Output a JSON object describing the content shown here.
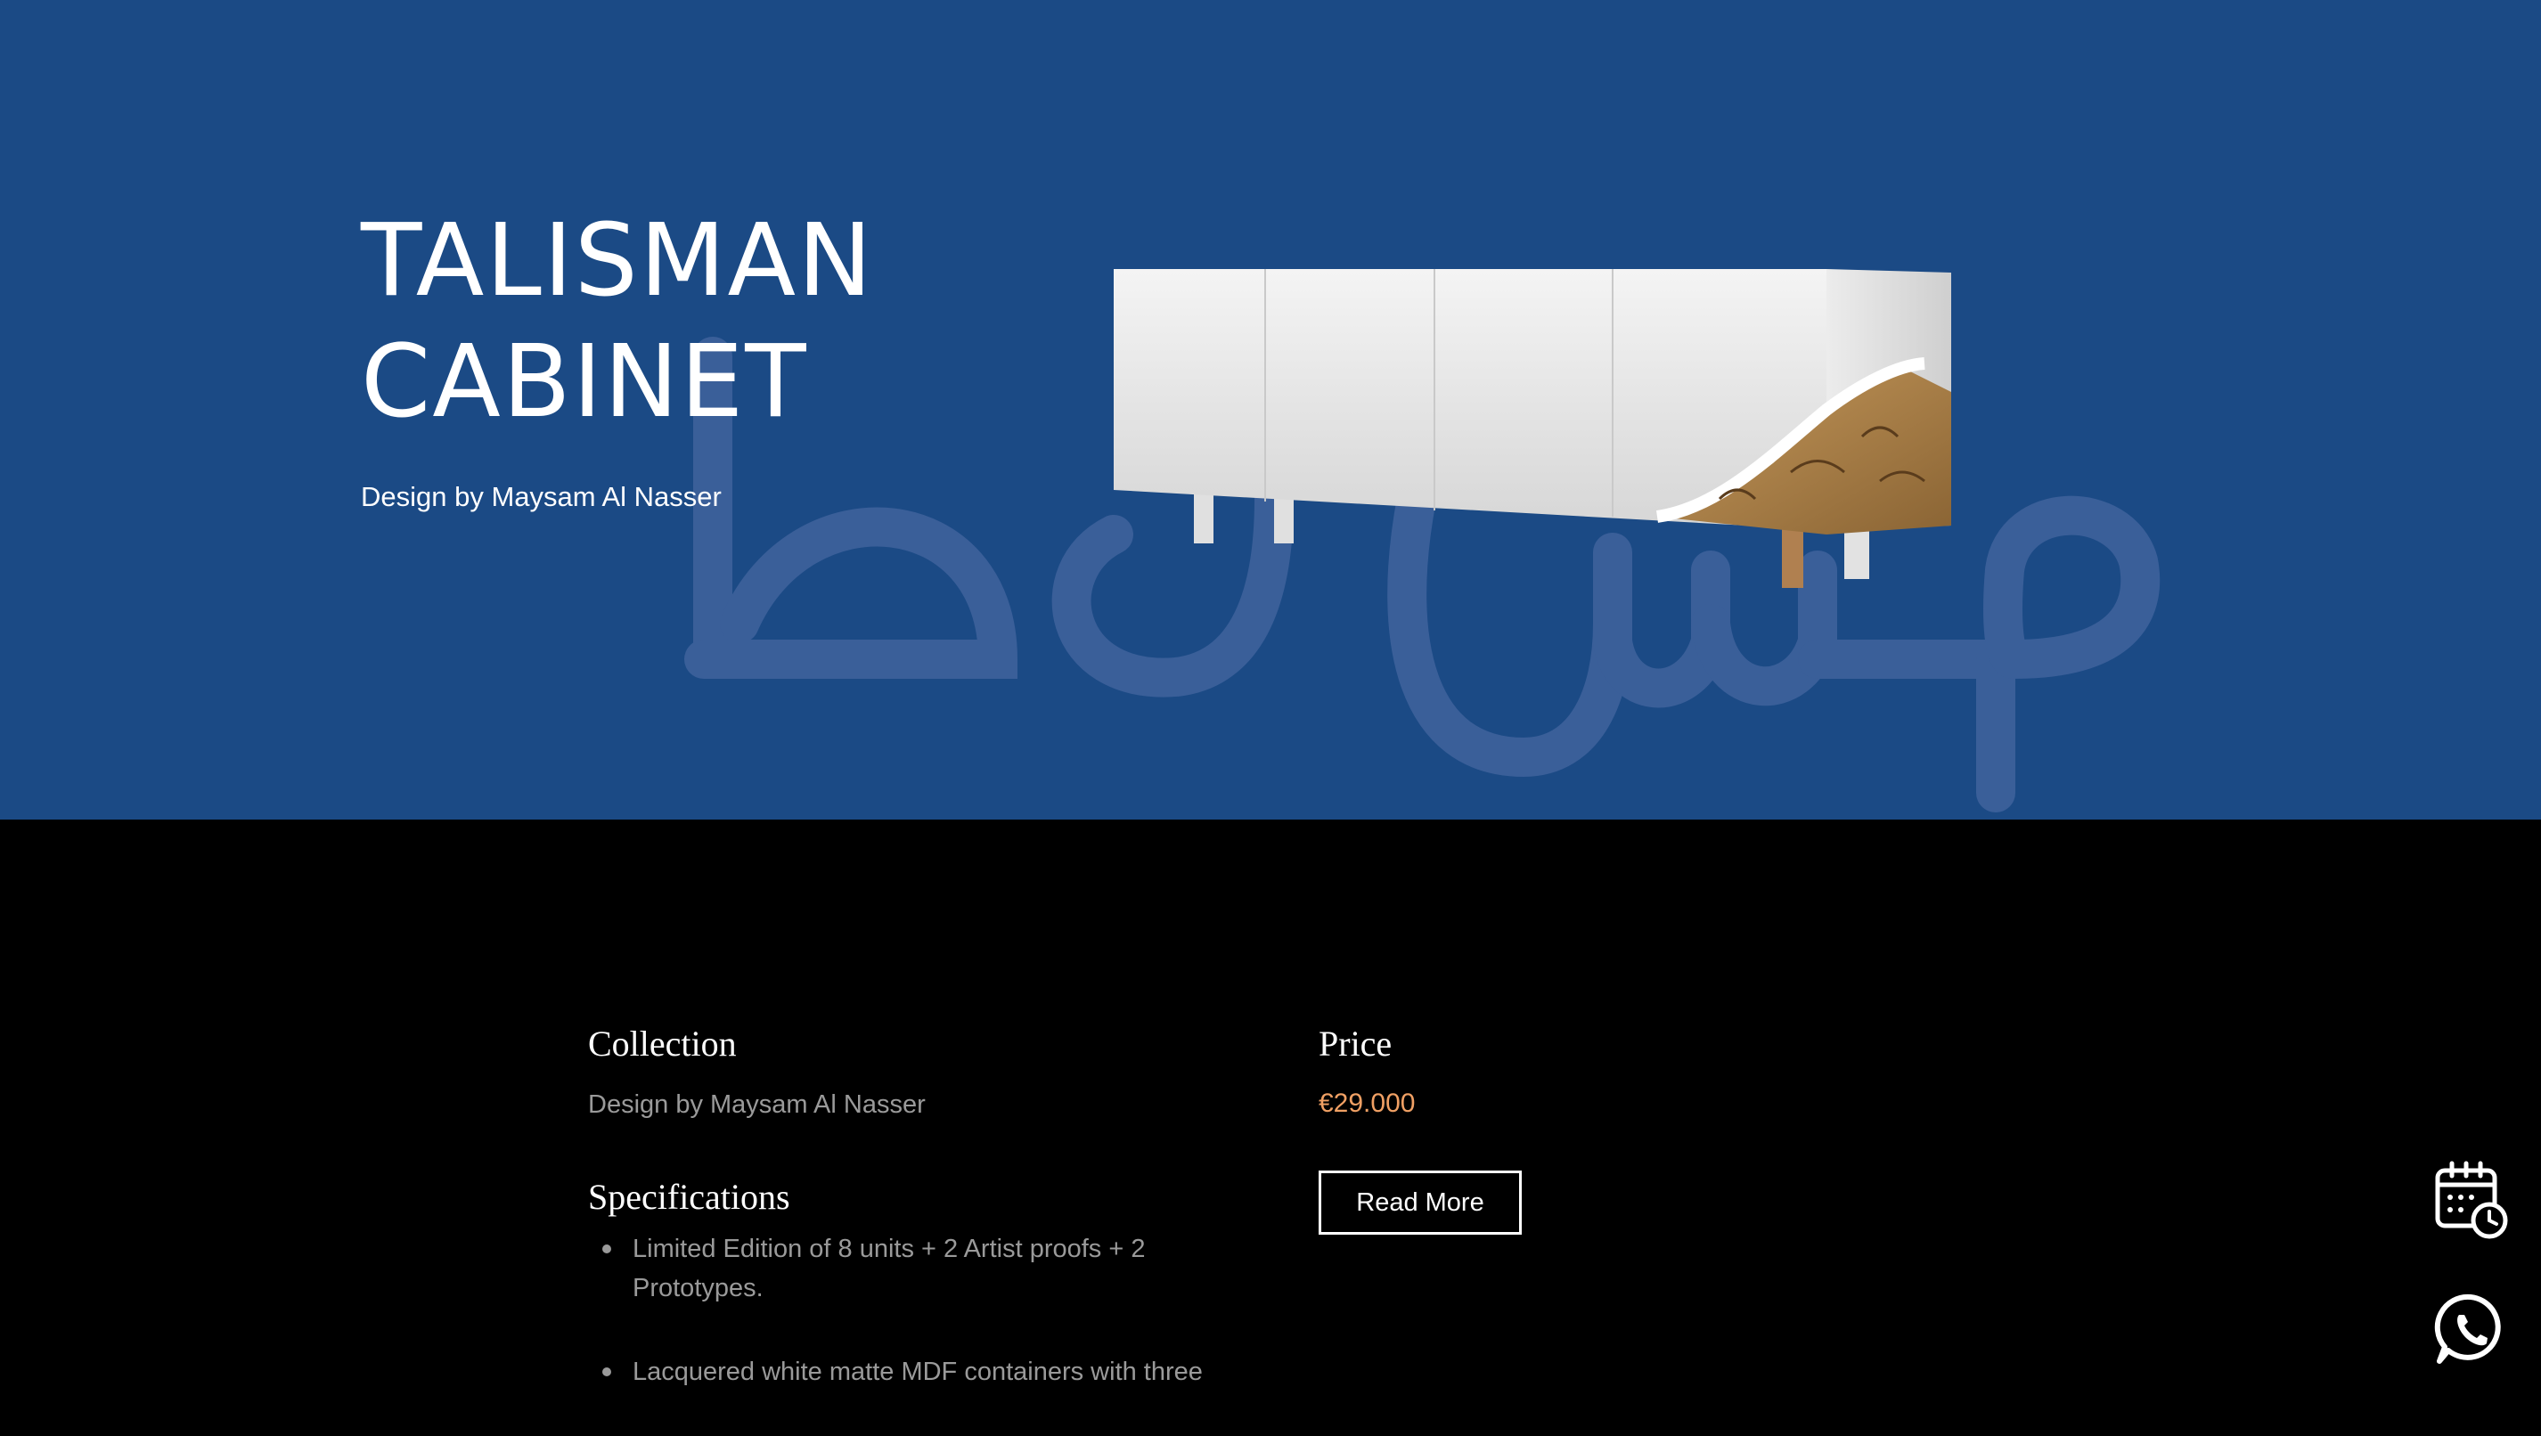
{
  "hero": {
    "title_line1": "TALISMAN",
    "title_line2": "CABINET",
    "subtitle": "Design by Maysam Al Nasser",
    "background_color": "#1b4a85"
  },
  "details": {
    "collection_heading": "Collection",
    "collection_text": "Design by Maysam Al Nasser",
    "price_heading": "Price",
    "price_value": "€29.000",
    "price_color": "#f0a064",
    "read_more_label": "Read More",
    "specifications_heading": "Specifications",
    "specifications": [
      "Limited Edition of 8 units + 2 Artist proofs + 2 Prototypes.",
      "Lacquered white matte MDF containers with three"
    ]
  },
  "floating_actions": {
    "appointment_icon": "calendar-clock-icon",
    "whatsapp_icon": "whatsapp-icon"
  }
}
